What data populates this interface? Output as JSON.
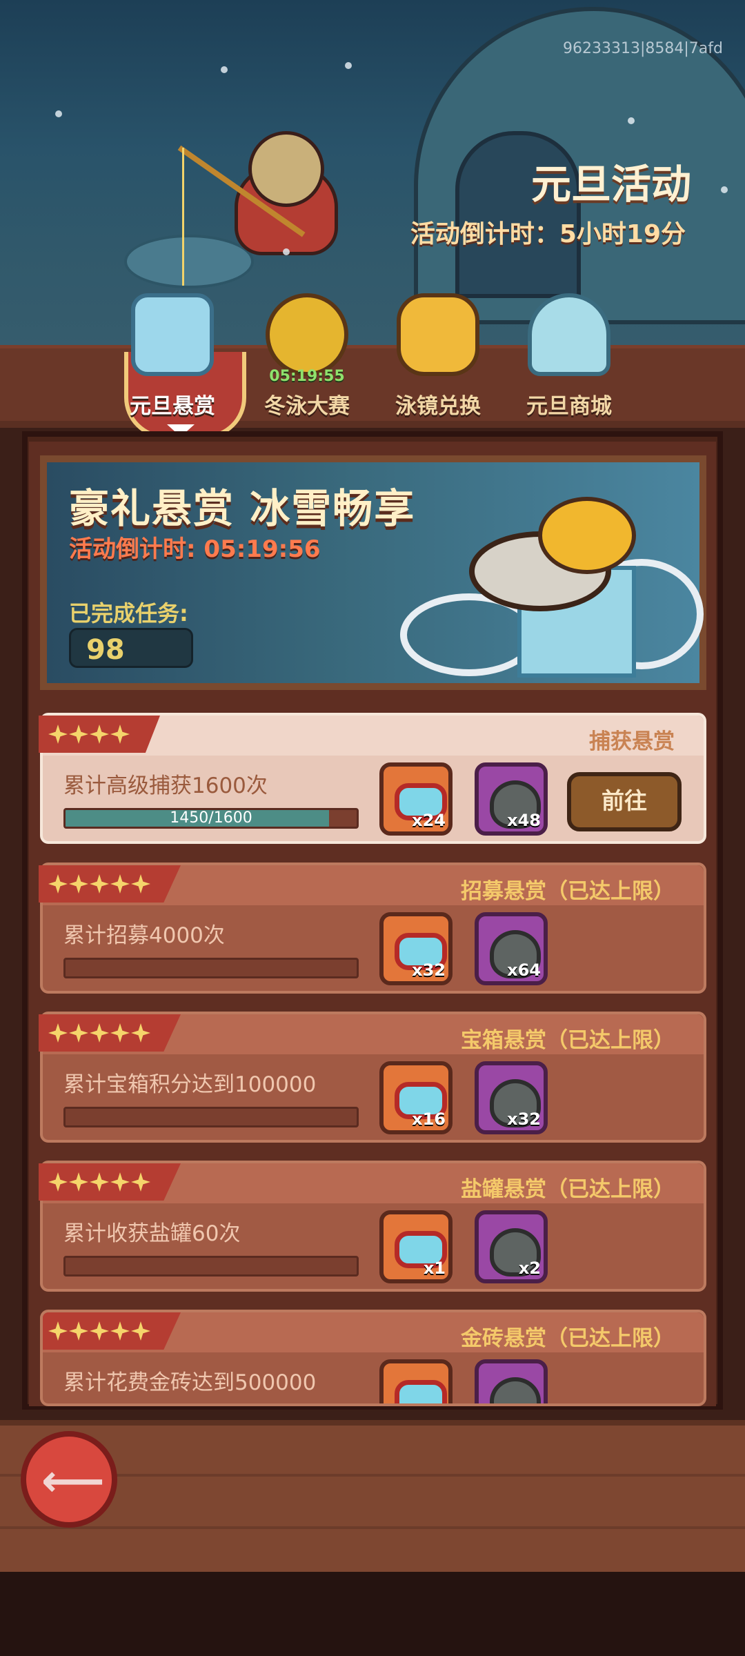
{
  "top_hud": {
    "event_id": "96233313|8584|7afd",
    "title": "元旦活动",
    "countdown": "活动倒计时：5小时19分"
  },
  "tabs": [
    {
      "label": "元旦悬赏",
      "icon": "ice-cube-icon",
      "active": true
    },
    {
      "label": "冬泳大赛",
      "icon": "golden-fish-icon",
      "time": "05:19:55"
    },
    {
      "label": "泳镜兑换",
      "icon": "goggles-icon"
    },
    {
      "label": "元旦商城",
      "icon": "igloo-icon"
    }
  ],
  "banner": {
    "title": "豪礼悬赏 冰雪畅享",
    "countdown": "活动倒计时: 05:19:56",
    "completed_label": "已完成任务:",
    "completed_value": "98"
  },
  "tasks": [
    {
      "type": "捕获悬赏",
      "description": "累计高级捕获1600次",
      "progress_text": "1450/1600",
      "progress": 0.906,
      "stars": 4,
      "rewards": [
        {
          "icon": "goggles-icon",
          "qty": "x24",
          "color": "#e3763a"
        },
        {
          "icon": "kettle-icon",
          "qty": "x48",
          "color": "#9a48a5"
        }
      ],
      "button_label": "前往"
    },
    {
      "type": "招募悬赏（已达上限）",
      "description": "累计招募4000次",
      "progress": 0,
      "stars": 5,
      "rewards": [
        {
          "icon": "goggles-icon",
          "qty": "x32",
          "color": "#e3763a"
        },
        {
          "icon": "kettle-icon",
          "qty": "x64",
          "color": "#9a48a5"
        }
      ]
    },
    {
      "type": "宝箱悬赏（已达上限）",
      "description": "累计宝箱积分达到100000",
      "progress": 0,
      "stars": 5,
      "rewards": [
        {
          "icon": "goggles-icon",
          "qty": "x16",
          "color": "#e3763a"
        },
        {
          "icon": "kettle-icon",
          "qty": "x32",
          "color": "#9a48a5"
        }
      ]
    },
    {
      "type": "盐罐悬赏（已达上限）",
      "description": "累计收获盐罐60次",
      "progress": 0,
      "stars": 5,
      "rewards": [
        {
          "icon": "goggles-icon",
          "qty": "x1",
          "color": "#e3763a"
        },
        {
          "icon": "kettle-icon",
          "qty": "x2",
          "color": "#9a48a5"
        }
      ]
    },
    {
      "type": "金砖悬赏（已达上限）",
      "description": "累计花费金砖达到500000",
      "progress": 0,
      "stars": 5,
      "rewards": [
        {
          "icon": "goggles-icon",
          "qty": "",
          "color": "#e3763a"
        },
        {
          "icon": "kettle-icon",
          "qty": "",
          "color": "#9a48a5"
        }
      ]
    }
  ],
  "colors": {
    "accent_red": "#b53d32",
    "gold": "#f5d56b",
    "progress_fill": "#4d8d86"
  }
}
